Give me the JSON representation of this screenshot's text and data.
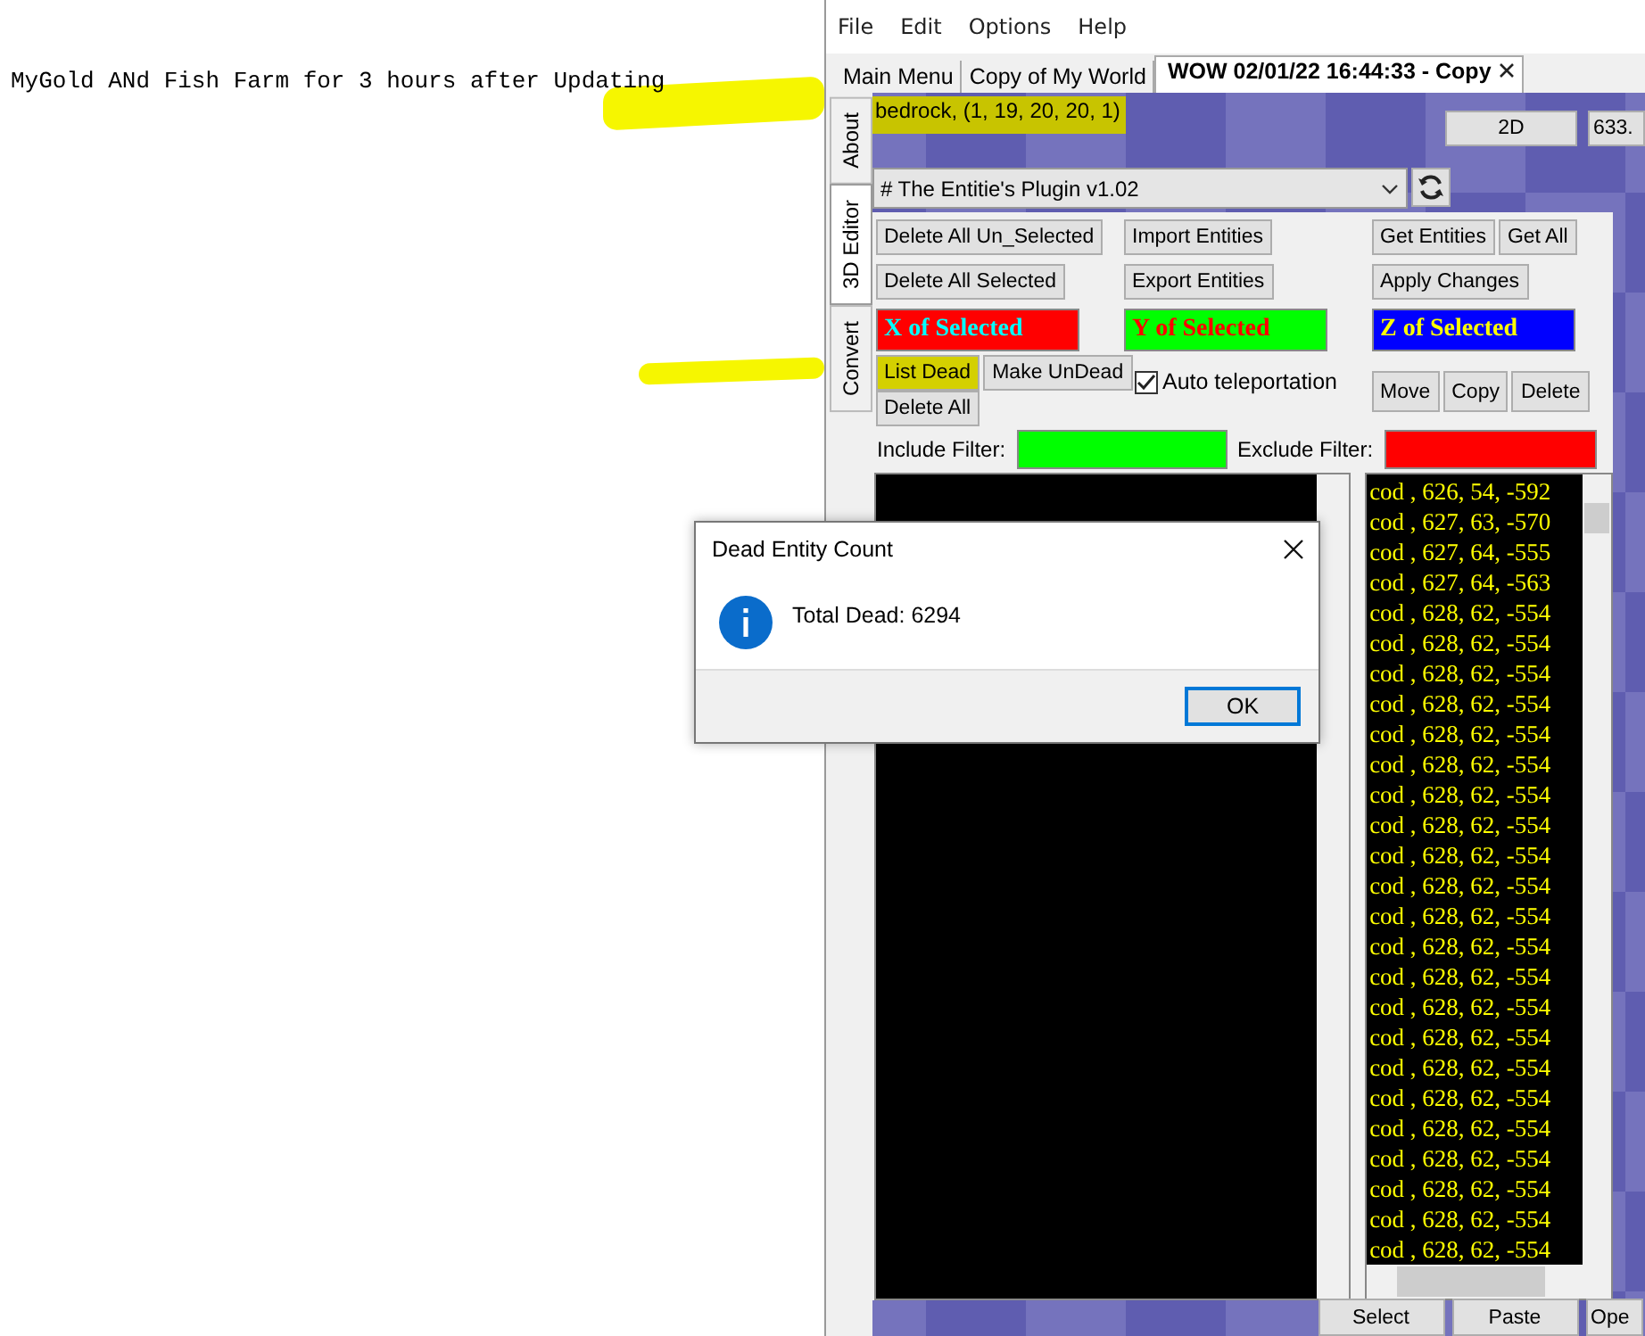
{
  "note": {
    "text": "MyGold ANd Fish Farm for 3 hours after Updating"
  },
  "menu": [
    "File",
    "Edit",
    "Options",
    "Help"
  ],
  "tabs": [
    {
      "label": "Main Menu",
      "selected": false,
      "closable": false
    },
    {
      "label": "Copy of My World",
      "selected": false,
      "closable": false
    },
    {
      "label": "WOW 02/01/22 16:44:33 - Copy",
      "selected": true,
      "closable": true
    }
  ],
  "side_tabs": [
    {
      "label": "About",
      "selected": false
    },
    {
      "label": "3D Editor",
      "selected": true
    },
    {
      "label": "Convert",
      "selected": false
    }
  ],
  "block_info": "bedrock, (1, 19, 20, 20, 1)",
  "view_buttons": [
    "2D",
    "633."
  ],
  "plugin_select": {
    "value": "# The Entitie's Plugin v1.02"
  },
  "column_1": {
    "buttons": [
      "Delete All Un_Selected",
      "Delete All Selected"
    ],
    "axis": {
      "label": "X of Selected",
      "color": "#ff0000",
      "kind": "x"
    },
    "buttons_2": [
      {
        "label": "List Dead",
        "highlighted": true
      },
      {
        "label": "Make UnDead",
        "highlighted": false
      }
    ],
    "buttons_3": [
      "Delete All"
    ]
  },
  "column_2": {
    "buttons": [
      "Import Entities",
      "Export Entities"
    ],
    "axis": {
      "label": "Y of Selected",
      "color": "#00ff00",
      "kind": "y"
    },
    "checkbox": {
      "label": "Auto teleportation",
      "checked": true
    }
  },
  "column_3": {
    "buttons": [
      "Get Entities",
      "Get All"
    ],
    "buttons_1b": [
      "Apply Changes"
    ],
    "axis": {
      "label": "Z of Selected",
      "color": "#0000ff",
      "kind": "z"
    },
    "buttons_2": [
      "Move",
      "Copy",
      "Delete"
    ]
  },
  "filters": [
    {
      "label": "Include Filter:",
      "color": "#00ff00"
    },
    {
      "label": "Exclude Filter:",
      "color": "#ff0000"
    }
  ],
  "entity_list": [
    "cod , 626, 54, -592",
    "cod , 627, 63, -570",
    "cod , 627, 64, -555",
    "cod , 627, 64, -563",
    "cod , 628, 62, -554",
    "cod , 628, 62, -554",
    "cod , 628, 62, -554",
    "cod , 628, 62, -554",
    "cod , 628, 62, -554",
    "cod , 628, 62, -554",
    "cod , 628, 62, -554",
    "cod , 628, 62, -554",
    "cod , 628, 62, -554",
    "cod , 628, 62, -554",
    "cod , 628, 62, -554",
    "cod , 628, 62, -554",
    "cod , 628, 62, -554",
    "cod , 628, 62, -554",
    "cod , 628, 62, -554",
    "cod , 628, 62, -554",
    "cod , 628, 62, -554",
    "cod , 628, 62, -554",
    "cod , 628, 62, -554",
    "cod , 628, 62, -554",
    "cod , 628, 62, -554",
    "cod , 628, 62, -554"
  ],
  "bottom_buttons": [
    "Select",
    "Paste",
    "Ope"
  ],
  "dialog": {
    "title": "Dead Entity Count",
    "message": "Total Dead: 6294",
    "button": "OK"
  }
}
